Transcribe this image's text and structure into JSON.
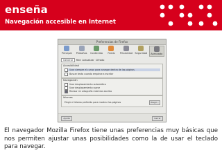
{
  "header": {
    "brand": "enseña",
    "subtitle": "Navegación accesible en Internet",
    "background_color": "#d6001c",
    "logo": "braille-dots-logo"
  },
  "dialog": {
    "title": "Preferencias de Firefox",
    "toolbar": [
      "Principal",
      "Pestañas",
      "Contenido",
      "Feeds",
      "Privacidad",
      "Seguridad",
      "Avanzado"
    ],
    "active_tab": "Avanzado",
    "tabs_row": [
      "General",
      "Red",
      "Actualizar",
      "Cifrado"
    ],
    "accessibility_group": {
      "title": "Accesibilidad",
      "options": [
        "Usar siempre el cursor para navegar dentro de las páginas",
        "Buscar texto cuando empiece a escribir"
      ]
    },
    "browsing_group": {
      "title": "Navegación",
      "options": [
        "Usar desplazamiento automático",
        "Usar desplazamiento suave",
        "Revisar mi ortografía mientras escribo"
      ]
    },
    "languages_group": {
      "title": "Idiomas",
      "text": "Elegir el idioma preferido para mostrar las páginas",
      "button": "Elegir..."
    },
    "footer_left": "Ayuda",
    "footer_right": "Cerrar"
  },
  "caption": "El navegador Mozilla Firefox tiene unas preferencias muy básicas que nos permiten ajustar unas posibilidades como la de usar el teclado para navegar."
}
